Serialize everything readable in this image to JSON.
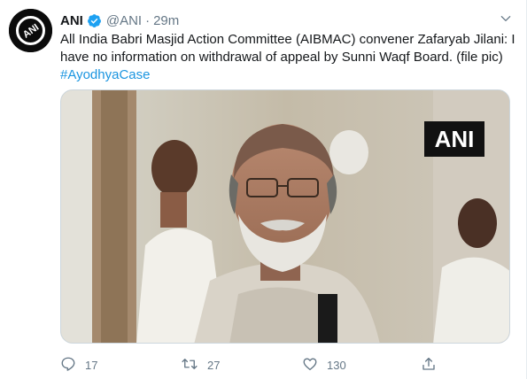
{
  "tweet": {
    "author_name": "ANI",
    "handle": "@ANI",
    "separator": "·",
    "time": "29m",
    "text": "All India Babri Masjid Action Committee (AIBMAC) convener Zafaryab Jilani: I have no information on withdrawal of appeal by Sunni Waqf Board. (file pic)",
    "hashtag": "#AyodhyaCase",
    "media_watermark": "ANI",
    "avatar_text": "ANI"
  },
  "actions": {
    "reply_count": "17",
    "retweet_count": "27",
    "like_count": "130"
  },
  "colors": {
    "link": "#1b95e0",
    "secondary_text": "#657786",
    "verified": "#1da1f2"
  },
  "icons": [
    "verified-badge-icon",
    "caret-down-icon",
    "reply-icon",
    "retweet-icon",
    "like-icon",
    "share-icon"
  ]
}
